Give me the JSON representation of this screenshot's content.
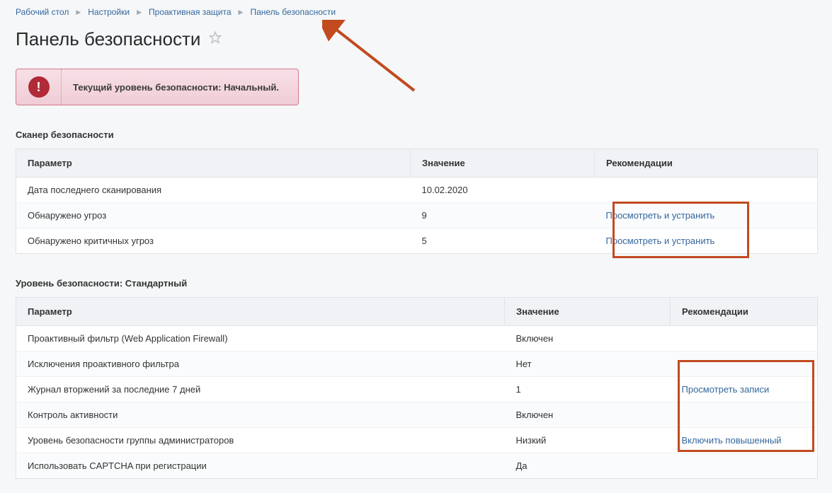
{
  "breadcrumbs": {
    "items": [
      "Рабочий стол",
      "Настройки",
      "Проактивная защита",
      "Панель безопасности"
    ]
  },
  "page_title": "Панель безопасности",
  "alert": {
    "text": "Текущий уровень безопасности: Начальный."
  },
  "section1": {
    "title": "Сканер безопасности",
    "headers": {
      "param": "Параметр",
      "value": "Значение",
      "reco": "Рекомендации"
    },
    "rows": [
      {
        "param": "Дата последнего сканирования",
        "value": "10.02.2020",
        "reco": ""
      },
      {
        "param": "Обнаружено угроз",
        "value": "9",
        "reco": "Просмотреть и устранить"
      },
      {
        "param": "Обнаружено критичных угроз",
        "value": "5",
        "reco": "Просмотреть и устранить"
      }
    ]
  },
  "section2": {
    "title": "Уровень безопасности: Стандартный",
    "headers": {
      "param": "Параметр",
      "value": "Значение",
      "reco": "Рекомендации"
    },
    "rows": [
      {
        "param": "Проактивный фильтр (Web Application Firewall)",
        "value": "Включен",
        "reco": ""
      },
      {
        "param": "Исключения проактивного фильтра",
        "value": "Нет",
        "reco": ""
      },
      {
        "param": "Журнал вторжений за последние 7 дней",
        "value": "1",
        "reco": "Просмотреть записи"
      },
      {
        "param": "Контроль активности",
        "value": "Включен",
        "reco": ""
      },
      {
        "param": "Уровень безопасности группы администраторов",
        "value": "Низкий",
        "reco": "Включить повышенный"
      },
      {
        "param": "Использовать CAPTCHA при регистрации",
        "value": "Да",
        "reco": ""
      }
    ]
  }
}
